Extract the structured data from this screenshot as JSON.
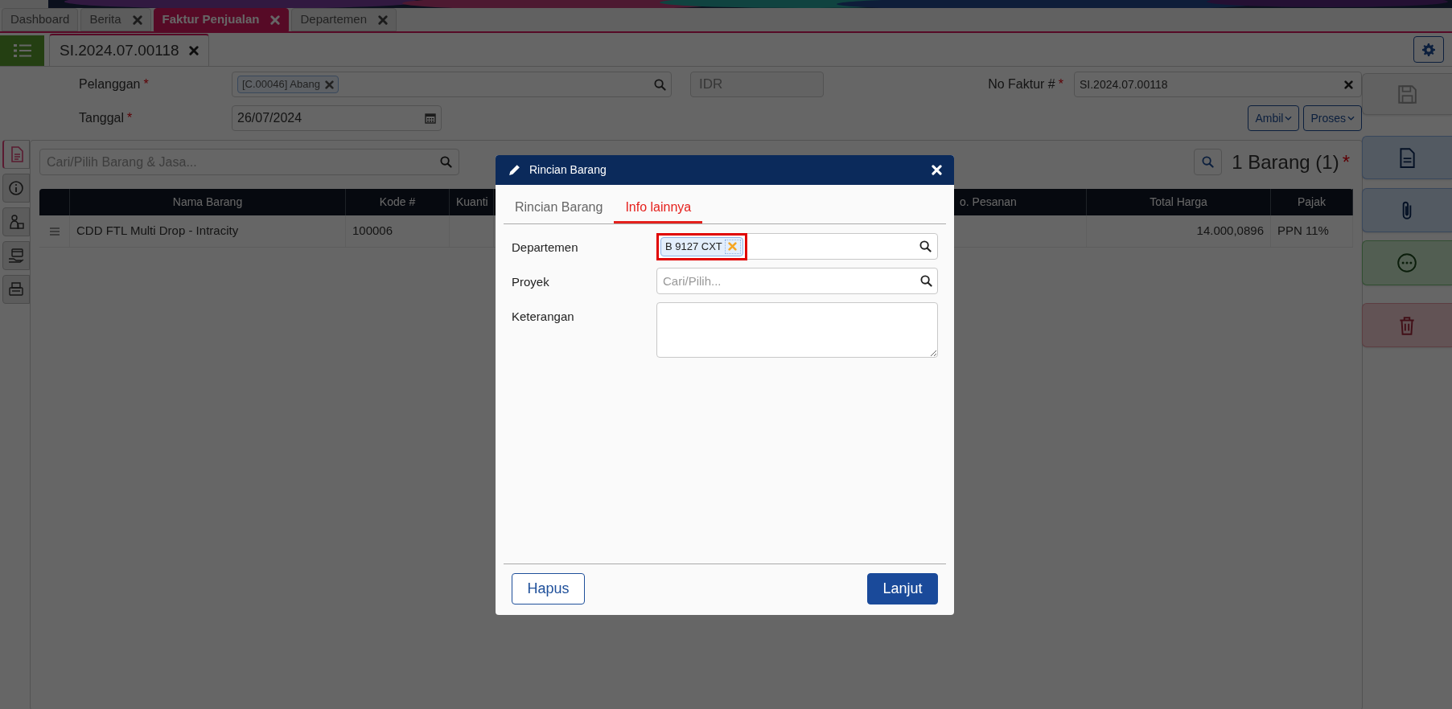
{
  "top_tabs": [
    {
      "label": "Dashboard",
      "closable": false,
      "selected": false
    },
    {
      "label": "Berita",
      "closable": true,
      "selected": false
    },
    {
      "label": "Faktur Penjualan",
      "closable": true,
      "selected": true
    },
    {
      "label": "Departemen",
      "closable": true,
      "selected": false
    }
  ],
  "document_tab": {
    "label": "SI.2024.07.00118",
    "selected": true
  },
  "form": {
    "pelanggan": {
      "label": "Pelanggan",
      "required_mark": "*",
      "chip": "[C.00046] Abang"
    },
    "currency": {
      "value": "IDR"
    },
    "no_faktur": {
      "label": "No Faktur #",
      "required_mark": "*",
      "value": "SI.2024.07.00118"
    },
    "tanggal": {
      "label": "Tanggal",
      "required_mark": "*",
      "value": "26/07/2024"
    }
  },
  "action_buttons": [
    "Ambil",
    "Proses"
  ],
  "side_tabs": [
    {
      "kind": "document",
      "selected": true
    },
    {
      "kind": "info",
      "selected": false
    },
    {
      "kind": "money",
      "selected": false
    },
    {
      "kind": "payment",
      "selected": false
    },
    {
      "kind": "tray",
      "selected": false
    }
  ],
  "right_buttons": [
    {
      "kind": "save"
    },
    {
      "kind": "document"
    },
    {
      "kind": "attach"
    },
    {
      "kind": "more"
    },
    {
      "kind": "delete"
    }
  ],
  "items": {
    "search": {
      "placeholder": "Cari/Pilih Barang & Jasa..."
    },
    "count": "1 Barang (1)",
    "required_mark": "*",
    "columns": [
      "Nama Barang",
      "Kode #",
      "Kuanti",
      "o. Pesanan",
      "Total Harga",
      "Pajak"
    ],
    "rows": [
      {
        "nama_barang": "CDD FTL Multi Drop - Intracity",
        "kode": "100006",
        "total_harga": "14.000,0896",
        "pajak": "PPN 11%"
      }
    ]
  },
  "dialog": {
    "title": "Rincian Barang",
    "tabs": [
      {
        "label": "Rincian Barang",
        "selected": false
      },
      {
        "label": "Info lainnya",
        "selected": true
      }
    ],
    "fields": [
      {
        "kind": "lookup",
        "label": "Departemen",
        "chips": [
          "B 9127 CXT"
        ],
        "highlighted": true
      },
      {
        "kind": "lookup",
        "label": "Proyek",
        "placeholder": "Cari/Pilih...",
        "highlighted": false
      },
      {
        "kind": "textarea",
        "label": "Keterangan",
        "highlighted": false
      }
    ],
    "buttons": [
      {
        "label": "Hapus",
        "kind": "secondary"
      },
      {
        "label": "Lanjut",
        "kind": "primary"
      }
    ]
  }
}
